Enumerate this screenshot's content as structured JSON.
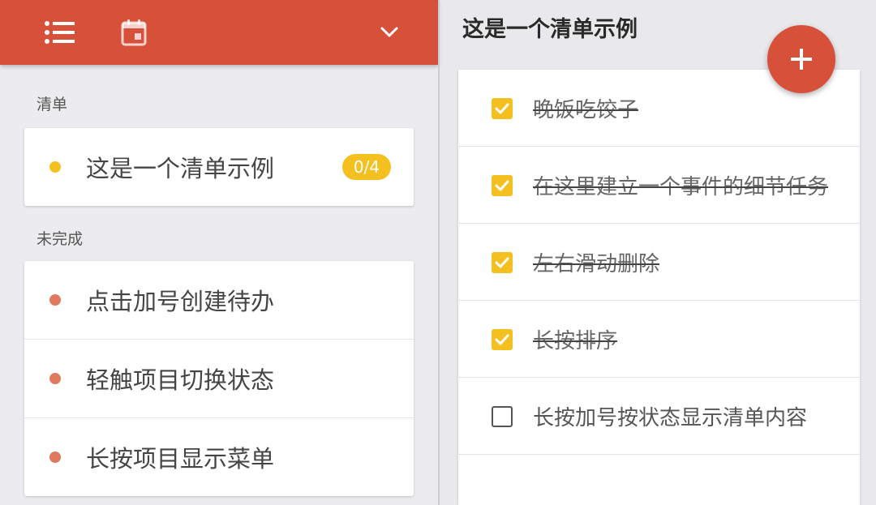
{
  "left": {
    "sections": [
      {
        "label": "清单",
        "items": [
          {
            "text": "这是一个清单示例",
            "badge": "0/4",
            "dot_color": "#f4c020"
          }
        ]
      },
      {
        "label": "未完成",
        "items": [
          {
            "text": "点击加号创建待办",
            "dot_color": "#e07a5f"
          },
          {
            "text": "轻触项目切换状态",
            "dot_color": "#e07a5f"
          },
          {
            "text": "长按项目显示菜单",
            "dot_color": "#e07a5f"
          }
        ]
      }
    ]
  },
  "right": {
    "title": "这是一个清单示例",
    "tasks": [
      {
        "text": "晚饭吃饺子",
        "done": true
      },
      {
        "text": "在这里建立一个事件的细节任务",
        "done": true
      },
      {
        "text": "左右滑动删除",
        "done": true
      },
      {
        "text": "长按排序",
        "done": true
      },
      {
        "text": "长按加号按状态显示清单内容",
        "done": false
      }
    ]
  },
  "colors": {
    "accent": "#d6503a",
    "yellow": "#f4c020",
    "dot_incomplete": "#e07a5f"
  },
  "icons": [
    "list-icon",
    "calendar-icon",
    "chevron-down-icon",
    "plus-icon",
    "check-icon"
  ]
}
